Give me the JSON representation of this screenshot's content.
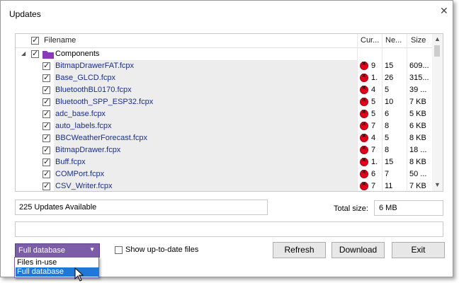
{
  "window": {
    "title": "Updates",
    "close_glyph": "✕"
  },
  "grid": {
    "columns": {
      "filename": "Filename",
      "current": "Cur...",
      "new": "Ne...",
      "size": "Size"
    },
    "group": {
      "label": "Components",
      "expander": "◢"
    },
    "rows": [
      {
        "name": "BitmapDrawerFAT.fcpx",
        "current": "9",
        "new": "15",
        "size": "609..."
      },
      {
        "name": "Base_GLCD.fcpx",
        "current": "1.",
        "new": "26",
        "size": "315..."
      },
      {
        "name": "BluetoothBL0170.fcpx",
        "current": "4",
        "new": "5",
        "size": "39 ..."
      },
      {
        "name": "Bluetooth_SPP_ESP32.fcpx",
        "current": "5",
        "new": "10",
        "size": "7 KB"
      },
      {
        "name": "adc_base.fcpx",
        "current": "5",
        "new": "6",
        "size": "5 KB"
      },
      {
        "name": "auto_labels.fcpx",
        "current": "7",
        "new": "8",
        "size": "6 KB"
      },
      {
        "name": "BBCWeatherForecast.fcpx",
        "current": "4",
        "new": "5",
        "size": "8 KB"
      },
      {
        "name": "BitmapDrawer.fcpx",
        "current": "7",
        "new": "8",
        "size": "18 ..."
      },
      {
        "name": "Buff.fcpx",
        "current": "1.",
        "new": "15",
        "size": "8 KB"
      },
      {
        "name": "COMPort.fcpx",
        "current": "6",
        "new": "7",
        "size": "50 ..."
      },
      {
        "name": "CSV_Writer.fcpx",
        "current": "7",
        "new": "11",
        "size": "7 KB"
      }
    ],
    "scroll": {
      "up": "▲",
      "down": "▼"
    }
  },
  "status": {
    "updates_available": "225 Updates Available",
    "total_size_label": "Total size:",
    "total_size_value": "6 MB",
    "progress_text": ""
  },
  "controls": {
    "database_select": "Full database",
    "database_options": [
      "Files in-use",
      "Full database"
    ],
    "show_uptodate_label": "Show up-to-date files",
    "refresh": "Refresh",
    "download": "Download",
    "exit": "Exit",
    "dropdown_arrow": "▼"
  },
  "colors": {
    "combo_bg": "#7b5ea7",
    "selected_option": "#1e78d7",
    "error_icon": "#e3001b",
    "filename_text": "#1a2f8a",
    "folder": "#8a3ab9"
  }
}
